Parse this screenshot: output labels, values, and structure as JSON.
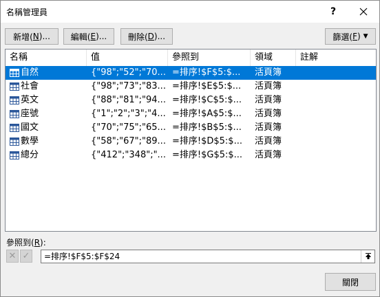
{
  "window": {
    "title": "名稱管理員",
    "help_label": "?",
    "close_icon": "close-icon"
  },
  "toolbar": {
    "new_text": "新增(",
    "new_mnemonic": "N",
    "new_suffix": ")...",
    "edit_text": "編輯(",
    "edit_mnemonic": "E",
    "edit_suffix": ")...",
    "delete_text": "刪除(",
    "delete_mnemonic": "D",
    "delete_suffix": ")...",
    "filter_text": "篩選(",
    "filter_mnemonic": "F",
    "filter_suffix": ")",
    "filter_caret": "▼"
  },
  "table": {
    "columns": [
      "名稱",
      "值",
      "參照到",
      "領域",
      "註解"
    ],
    "rows": [
      {
        "name": "自然",
        "value": "{\"98\";\"52\";\"70...",
        "ref": "=排序!$F$5:$...",
        "scope": "活頁簿",
        "comment": "",
        "selected": true
      },
      {
        "name": "社會",
        "value": "{\"98\";\"73\";\"83...",
        "ref": "=排序!$E$5:$...",
        "scope": "活頁簿",
        "comment": "",
        "selected": false
      },
      {
        "name": "英文",
        "value": "{\"88\";\"81\";\"94...",
        "ref": "=排序!$C$5:$...",
        "scope": "活頁簿",
        "comment": "",
        "selected": false
      },
      {
        "name": "座號",
        "value": "{\"1\";\"2\";\"3\";\"4...",
        "ref": "=排序!$A$5:$...",
        "scope": "活頁簿",
        "comment": "",
        "selected": false
      },
      {
        "name": "國文",
        "value": "{\"70\";\"75\";\"65...",
        "ref": "=排序!$B$5:$...",
        "scope": "活頁簿",
        "comment": "",
        "selected": false
      },
      {
        "name": "數學",
        "value": "{\"58\";\"67\";\"89...",
        "ref": "=排序!$D$5:$...",
        "scope": "活頁簿",
        "comment": "",
        "selected": false
      },
      {
        "name": "總分",
        "value": "{\"412\";\"348\";\"...",
        "ref": "=排序!$G$5:$...",
        "scope": "活頁簿",
        "comment": "",
        "selected": false
      }
    ]
  },
  "reference": {
    "label_text": "參照到(",
    "label_mnemonic": "R",
    "label_suffix": "):",
    "value": "=排序!$F$5:$F$24",
    "cancel_glyph": "✕",
    "confirm_glyph": "✓"
  },
  "footer": {
    "close_label": "關閉"
  },
  "colors": {
    "selection": "#0078d7",
    "background": "#f0f0f0"
  }
}
